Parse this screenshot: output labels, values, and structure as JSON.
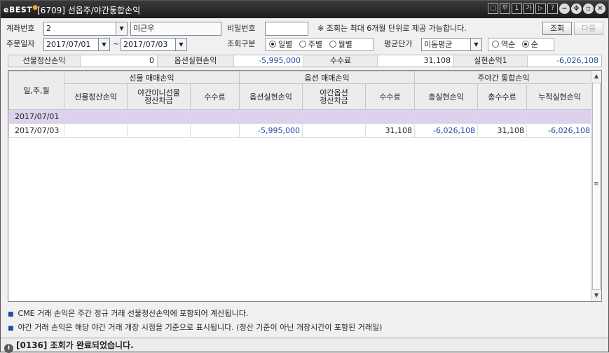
{
  "window": {
    "logo": "BEST",
    "title": "[6709] 선옵주/야간통합손익"
  },
  "titlebar_buttons": [
    "□",
    "平",
    "1",
    "가",
    "▷",
    "?"
  ],
  "form": {
    "account_label": "계좌번호",
    "account_value": "2",
    "account_name": "이근우",
    "password_label": "비밀번호",
    "notice": "※ 조회는 최대 6개월 단위로 제공 가능합니다.",
    "query_btn": "조회",
    "next_btn": "다음",
    "order_date_label": "주문일자",
    "date_from": "2017/07/01",
    "range_sep": "~",
    "date_to": "2017/07/03",
    "query_type_label": "조회구분",
    "query_types": [
      "일별",
      "주별",
      "월별"
    ],
    "avg_price_label": "평균단가",
    "avg_price_value": "이동평균",
    "orders": [
      "역순",
      "순"
    ]
  },
  "summary": {
    "f_label": "선물정산손익",
    "f_value": "0",
    "o_label": "옵션실현손익",
    "o_value": "-5,995,000",
    "fee_label": "수수료",
    "fee_value": "31,108",
    "r_label": "실현손익1",
    "r_value": "-6,026,108"
  },
  "grid": {
    "date_header": "일,주,월",
    "groups": [
      "선물 매매손익",
      "옵션 매매손익",
      "주야간 통합손익"
    ],
    "cols": [
      "선물정산손익",
      "야간미니선물\n정산차금",
      "수수료",
      "옵션실현손익",
      "야간옵션\n정산차금",
      "수수료",
      "총실현손익",
      "총수수료",
      "누적실현손익"
    ],
    "rows": [
      {
        "date": "2017/07/01",
        "c1": "",
        "c2": "",
        "c3": "",
        "c4": "",
        "c5": "",
        "c6": "",
        "c7": "",
        "c8": "",
        "c9": ""
      },
      {
        "date": "2017/07/03",
        "c1": "",
        "c2": "",
        "c3": "",
        "c4": "-5,995,000",
        "c5": "",
        "c6": "31,108",
        "c7": "-6,026,108",
        "c8": "31,108",
        "c9": "-6,026,108"
      }
    ]
  },
  "notes": [
    "CME 거래 손익은 주간 정규 거래 선물정산손익에 포함되어 계산됩니다.",
    "야간 거래 손익은 해당 야간 거래 개장 시점을 기준으로 표시됩니다. (정산 기준이 아닌 개장시간이 포함된 거래일)"
  ],
  "status": "[0136] 조회가 완료되었습니다."
}
